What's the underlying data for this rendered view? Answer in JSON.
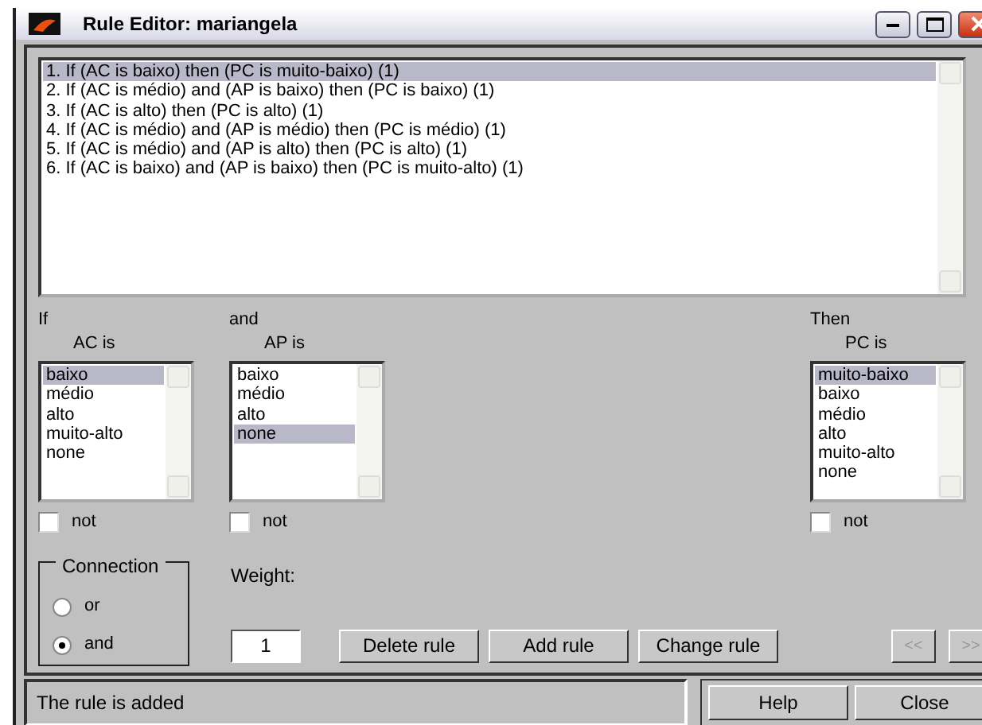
{
  "window": {
    "title": "Rule Editor: mariangela"
  },
  "rules": [
    {
      "text": "1. If (AC is baixo) then (PC is muito-baixo) (1)",
      "selected": true
    },
    {
      "text": "2. If (AC is médio) and (AP is baixo) then (PC is baixo) (1)",
      "selected": false
    },
    {
      "text": "3. If (AC is alto) then (PC is alto) (1)",
      "selected": false
    },
    {
      "text": "4. If (AC is médio) and (AP is médio) then (PC is médio) (1)",
      "selected": false
    },
    {
      "text": "5. If (AC is médio) and (AP is alto) then (PC is alto) (1)",
      "selected": false
    },
    {
      "text": "6. If (AC is baixo) and (AP is baixo) then (PC is muito-alto) (1)",
      "selected": false
    }
  ],
  "variables": [
    {
      "kind": "input",
      "connector": "If",
      "label": "AC is",
      "options": [
        {
          "text": "baixo",
          "selected": true
        },
        {
          "text": "médio",
          "selected": false
        },
        {
          "text": "alto",
          "selected": false
        },
        {
          "text": "muito-alto",
          "selected": false
        },
        {
          "text": "none",
          "selected": false
        }
      ],
      "not": {
        "label": "not",
        "checked": false
      }
    },
    {
      "kind": "input",
      "connector": "and",
      "label": "AP is",
      "options": [
        {
          "text": "baixo",
          "selected": false
        },
        {
          "text": "médio",
          "selected": false
        },
        {
          "text": "alto",
          "selected": false
        },
        {
          "text": "none",
          "selected": true
        }
      ],
      "not": {
        "label": "not",
        "checked": false
      }
    },
    {
      "kind": "output",
      "connector": "Then",
      "label": "PC is",
      "options": [
        {
          "text": "muito-baixo",
          "selected": true
        },
        {
          "text": "baixo",
          "selected": false
        },
        {
          "text": "médio",
          "selected": false
        },
        {
          "text": "alto",
          "selected": false
        },
        {
          "text": "muito-alto",
          "selected": false
        },
        {
          "text": "none",
          "selected": false
        }
      ],
      "not": {
        "label": "not",
        "checked": false
      }
    }
  ],
  "connection": {
    "title": "Connection",
    "options": [
      {
        "label": "or",
        "selected": false
      },
      {
        "label": "and",
        "selected": true
      }
    ]
  },
  "weight": {
    "label": "Weight:",
    "value": "1"
  },
  "rule_buttons": [
    {
      "label": "Delete rule",
      "disabled": false
    },
    {
      "label": "Add rule",
      "disabled": false
    },
    {
      "label": "Change rule",
      "disabled": false
    }
  ],
  "nav_buttons": [
    {
      "label": "<<",
      "disabled": true
    },
    {
      "label": ">>",
      "disabled": true
    }
  ],
  "status": "The rule is added",
  "footer_buttons": [
    {
      "label": "Help"
    },
    {
      "label": "Close"
    }
  ]
}
